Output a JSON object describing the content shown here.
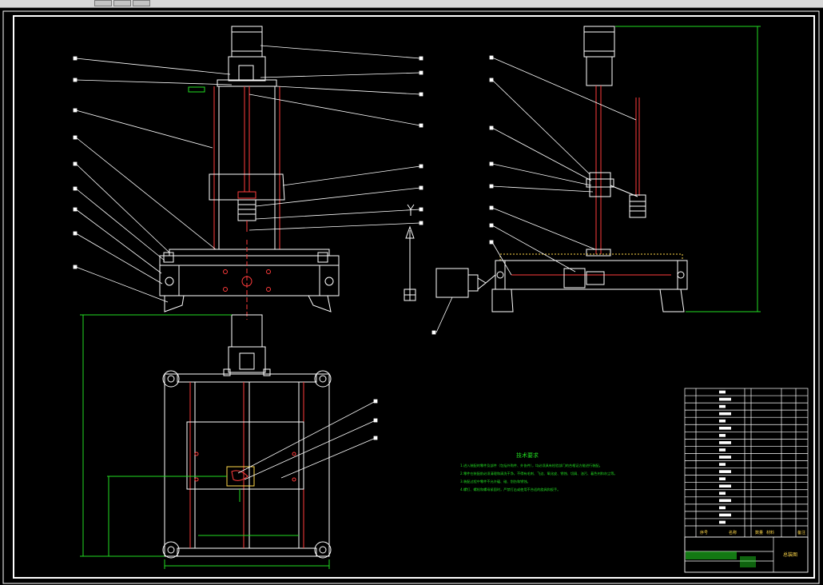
{
  "window": {
    "title_fragment": "",
    "controls": [
      "minimize",
      "maximize",
      "close"
    ]
  },
  "drawing": {
    "tech_notes_title": "技术要求",
    "tech_notes": [
      "1.进入装配的零件及部件（包括外购件、外协件），均必须具有检验部门的合格证方能进行装配。",
      "2.零件在装配前必须清理和清洗干净，不得有毛刺、飞边、氧化皮、锈蚀、切屑、油污、着色剂和灰尘等。",
      "3.装配过程中零件不允许磕、碰、划伤和锈蚀。",
      "4.螺钉、螺栓和螺母紧固时，严禁打击或使用不合适的旋具和扳手。"
    ],
    "dimension_labels": {
      "left_height": "",
      "bottom_width": "",
      "inner_width": "",
      "inner_height": "",
      "right_height": ""
    },
    "title_block": {
      "header_cells": [
        "序号",
        "名称",
        "数量",
        "材料",
        "备注"
      ],
      "drawing_title": "总装图"
    }
  },
  "colors": {
    "background": "#000000",
    "line_white": "#ffffff",
    "line_red": "#ff3b3b",
    "line_green": "#22dd22",
    "highlight_yellow": "#ffd84a"
  }
}
